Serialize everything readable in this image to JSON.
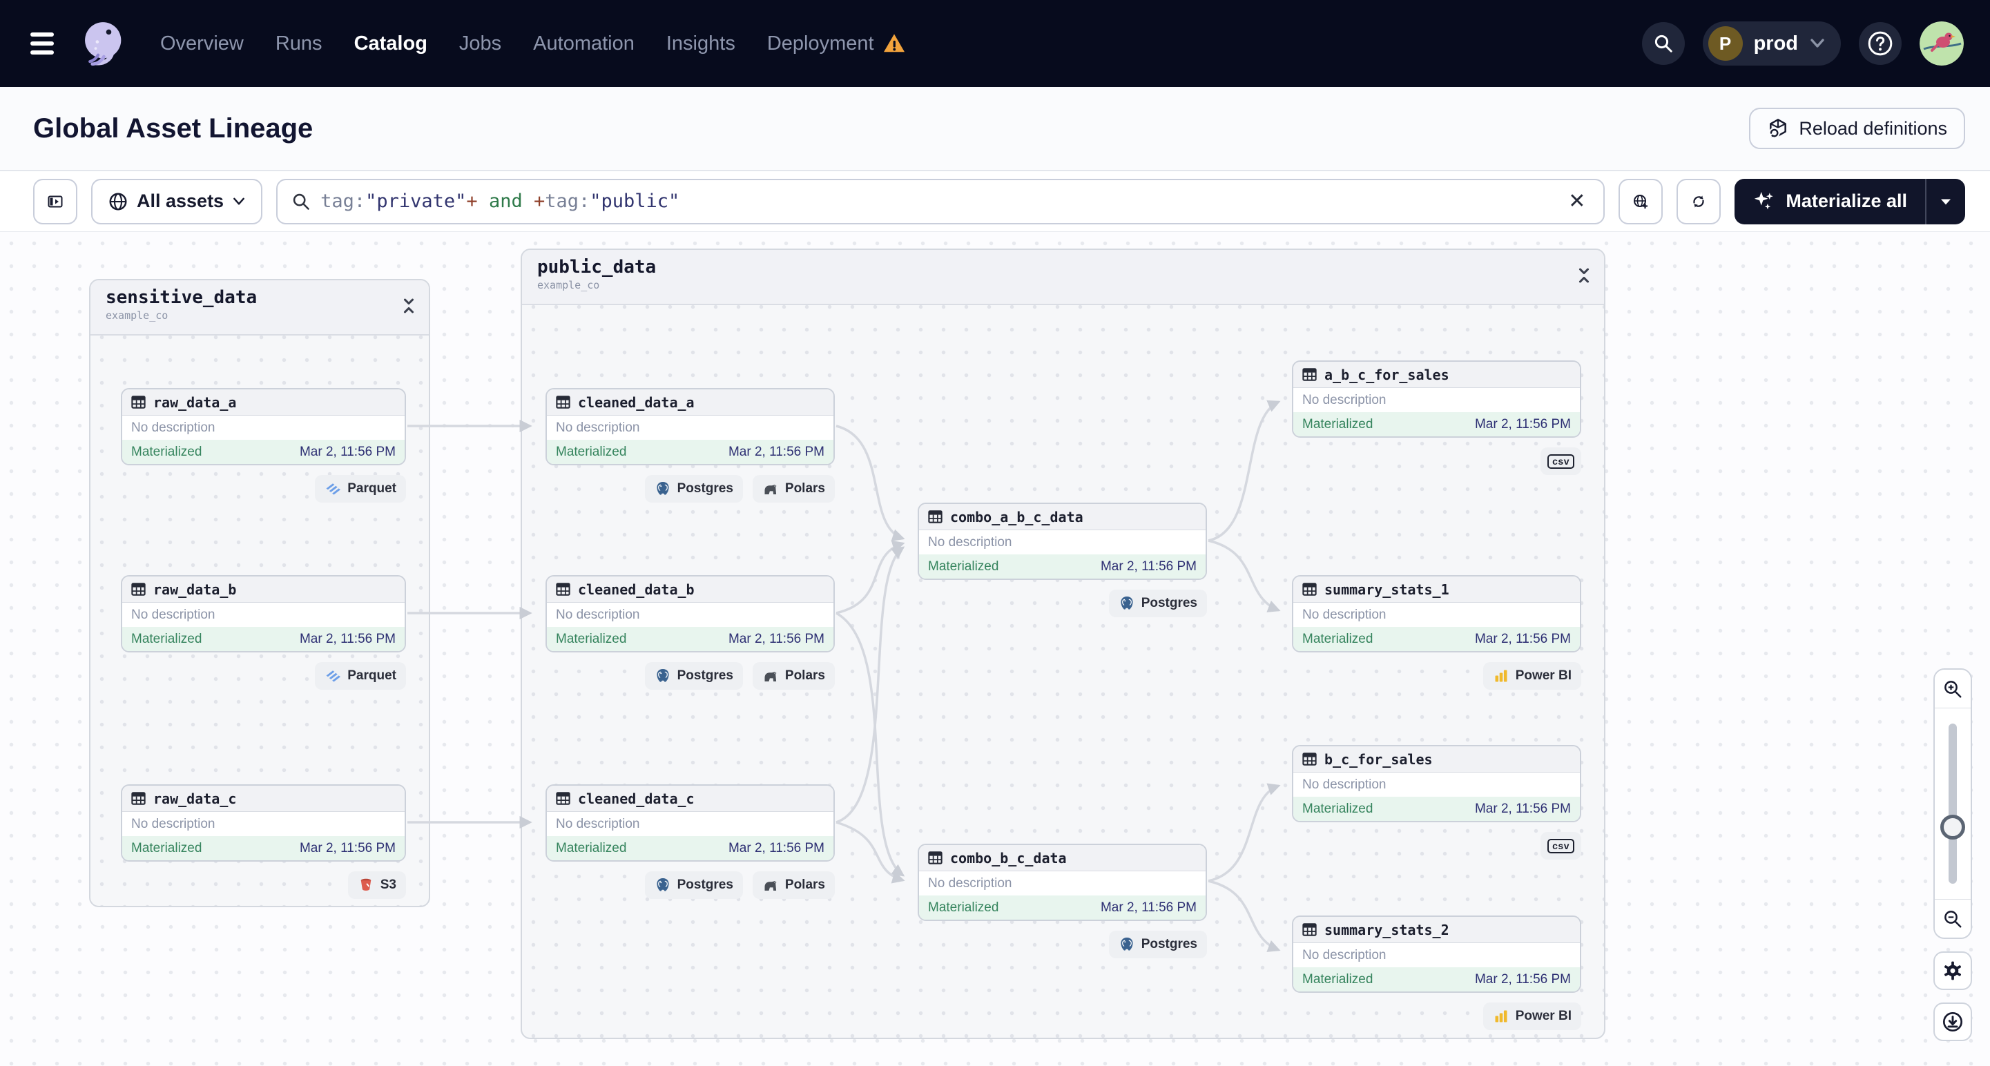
{
  "nav": {
    "items": [
      {
        "label": "Overview"
      },
      {
        "label": "Runs"
      },
      {
        "label": "Catalog",
        "active": true
      },
      {
        "label": "Jobs"
      },
      {
        "label": "Automation"
      },
      {
        "label": "Insights"
      },
      {
        "label": "Deployment",
        "warning": true
      }
    ],
    "env": {
      "initial": "P",
      "name": "prod"
    }
  },
  "header": {
    "title": "Global Asset Lineage",
    "reload_button": "Reload definitions"
  },
  "toolbar": {
    "scope_label": "All assets",
    "search": {
      "query_full": "tag:\"private\"+ and +tag:\"public\"",
      "parts": [
        {
          "text": "tag:",
          "role": "key"
        },
        {
          "text": "\"private\"",
          "role": "value"
        },
        {
          "text": "+",
          "role": "plus"
        },
        {
          "text": " and ",
          "role": "keyword"
        },
        {
          "text": "+",
          "role": "plus"
        },
        {
          "text": "tag:",
          "role": "key"
        },
        {
          "text": "\"public\"",
          "role": "value"
        }
      ]
    },
    "materialize_button": "Materialize all"
  },
  "groups": [
    {
      "name": "sensitive_data",
      "repo": "example_co"
    },
    {
      "name": "public_data",
      "repo": "example_co"
    }
  ],
  "nodes": [
    {
      "name": "raw_data_a",
      "description": "No description",
      "status": "Materialized",
      "timestamp": "Mar 2, 11:56 PM",
      "tags": [
        "Parquet"
      ]
    },
    {
      "name": "raw_data_b",
      "description": "No description",
      "status": "Materialized",
      "timestamp": "Mar 2, 11:56 PM",
      "tags": [
        "Parquet"
      ]
    },
    {
      "name": "raw_data_c",
      "description": "No description",
      "status": "Materialized",
      "timestamp": "Mar 2, 11:56 PM",
      "tags": [
        "S3"
      ]
    },
    {
      "name": "cleaned_data_a",
      "description": "No description",
      "status": "Materialized",
      "timestamp": "Mar 2, 11:56 PM",
      "tags": [
        "Postgres",
        "Polars"
      ]
    },
    {
      "name": "cleaned_data_b",
      "description": "No description",
      "status": "Materialized",
      "timestamp": "Mar 2, 11:56 PM",
      "tags": [
        "Postgres",
        "Polars"
      ]
    },
    {
      "name": "cleaned_data_c",
      "description": "No description",
      "status": "Materialized",
      "timestamp": "Mar 2, 11:56 PM",
      "tags": [
        "Postgres",
        "Polars"
      ]
    },
    {
      "name": "combo_a_b_c_data",
      "description": "No description",
      "status": "Materialized",
      "timestamp": "Mar 2, 11:56 PM",
      "tags": [
        "Postgres"
      ]
    },
    {
      "name": "a_b_c_for_sales",
      "description": "No description",
      "status": "Materialized",
      "timestamp": "Mar 2, 11:56 PM",
      "tags": [
        "csv"
      ]
    },
    {
      "name": "summary_stats_1",
      "description": "No description",
      "status": "Materialized",
      "timestamp": "Mar 2, 11:56 PM",
      "tags": [
        "Power BI"
      ]
    },
    {
      "name": "b_c_for_sales",
      "description": "No description",
      "status": "Materialized",
      "timestamp": "Mar 2, 11:56 PM",
      "tags": [
        "csv"
      ]
    },
    {
      "name": "combo_b_c_data",
      "description": "No description",
      "status": "Materialized",
      "timestamp": "Mar 2, 11:56 PM",
      "tags": [
        "Postgres"
      ]
    },
    {
      "name": "summary_stats_2",
      "description": "No description",
      "status": "Materialized",
      "timestamp": "Mar 2, 11:56 PM",
      "tags": [
        "Power BI"
      ]
    }
  ],
  "colors": {
    "nav_bg": "#070b1d",
    "status_green": "#35845d",
    "timestamp_indigo": "#2d2f73",
    "warning_orange": "#f2a33c",
    "materialize_bg": "#11152a",
    "edge_gray": "#d5d8df"
  }
}
